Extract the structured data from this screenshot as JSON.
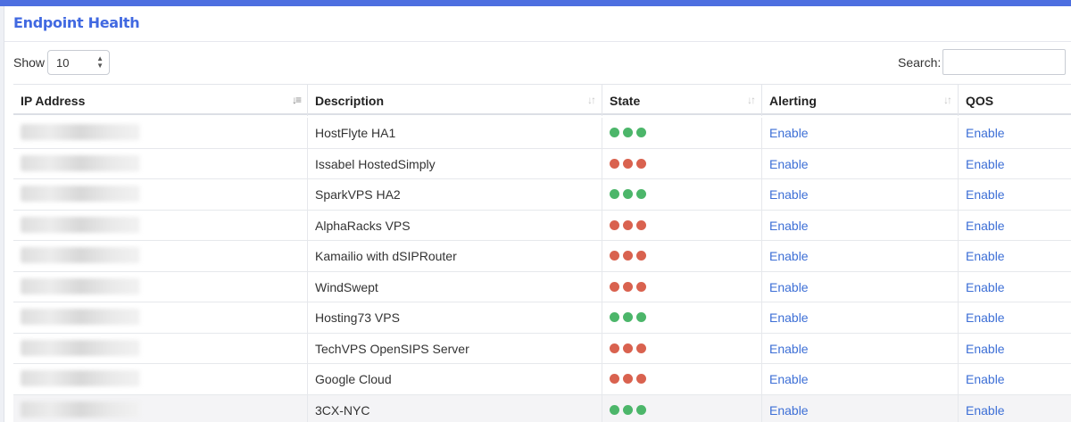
{
  "header": {
    "title": "Endpoint Health"
  },
  "controls": {
    "show_label": "Show",
    "show_value": "10",
    "search_label": "Search:",
    "search_value": ""
  },
  "colors": {
    "accent": "#4169e1",
    "state_up": "#4cb66a",
    "state_down": "#d9624f",
    "link": "#3d6fd6"
  },
  "table": {
    "columns": [
      {
        "label": "IP Address",
        "sort_icon": "sort-desc-icon"
      },
      {
        "label": "Description",
        "sort_icon": "sort-icon"
      },
      {
        "label": "State",
        "sort_icon": "sort-icon"
      },
      {
        "label": "Alerting",
        "sort_icon": "sort-icon"
      },
      {
        "label": "QOS",
        "sort_icon": ""
      }
    ],
    "rows": [
      {
        "description": "HostFlyte HA1",
        "state": "up",
        "alerting": "Enable",
        "qos": "Enable"
      },
      {
        "description": "Issabel HostedSimply",
        "state": "down",
        "alerting": "Enable",
        "qos": "Enable"
      },
      {
        "description": "SparkVPS HA2",
        "state": "up",
        "alerting": "Enable",
        "qos": "Enable"
      },
      {
        "description": "AlphaRacks VPS",
        "state": "down",
        "alerting": "Enable",
        "qos": "Enable"
      },
      {
        "description": "Kamailio with dSIPRouter",
        "state": "down",
        "alerting": "Enable",
        "qos": "Enable"
      },
      {
        "description": "WindSwept",
        "state": "down",
        "alerting": "Enable",
        "qos": "Enable"
      },
      {
        "description": "Hosting73 VPS",
        "state": "up",
        "alerting": "Enable",
        "qos": "Enable"
      },
      {
        "description": "TechVPS OpenSIPS Server",
        "state": "down",
        "alerting": "Enable",
        "qos": "Enable"
      },
      {
        "description": "Google Cloud",
        "state": "down",
        "alerting": "Enable",
        "qos": "Enable"
      },
      {
        "description": "3CX-NYC",
        "state": "up",
        "alerting": "Enable",
        "qos": "Enable"
      }
    ]
  }
}
